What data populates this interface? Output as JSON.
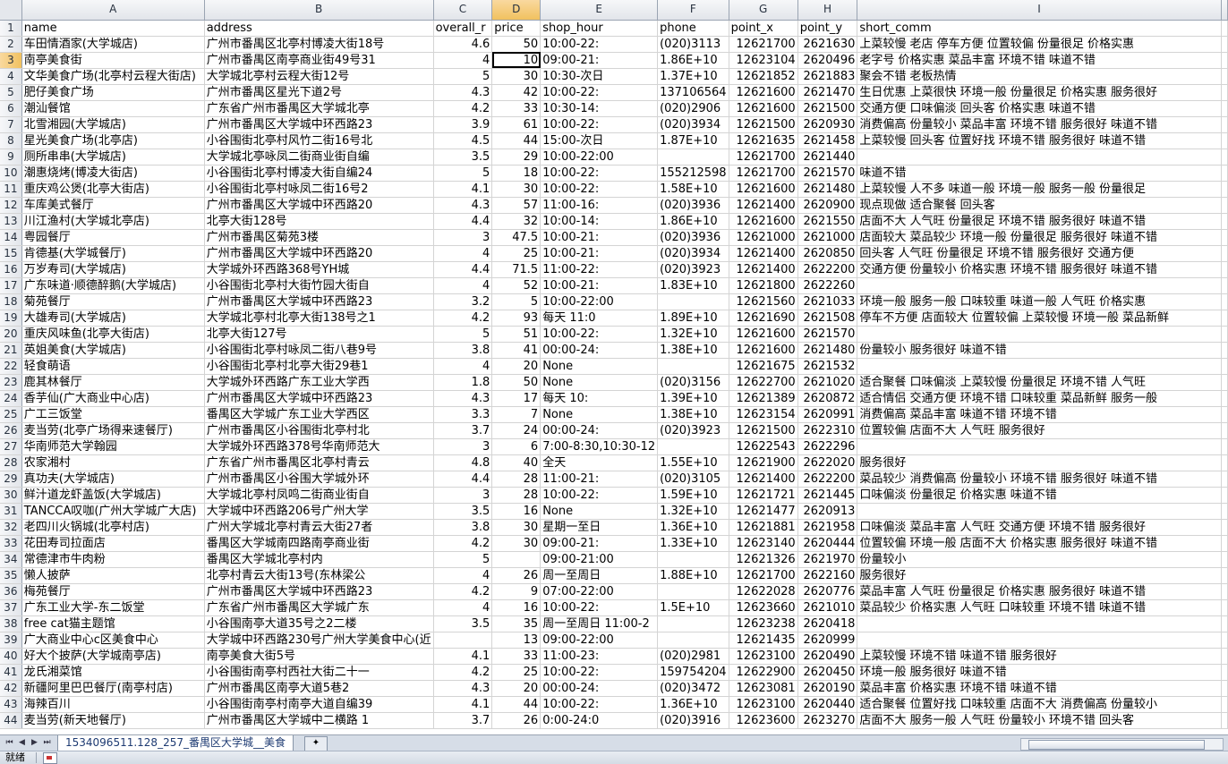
{
  "columns": [
    "A",
    "B",
    "C",
    "D",
    "E",
    "F",
    "G",
    "H",
    "I"
  ],
  "selected_column": "D",
  "selected_row": 3,
  "rows": [
    {
      "n": "1",
      "c": [
        "name",
        "address",
        "overall_r",
        "price",
        "shop_hour",
        "phone",
        "point_x",
        "point_y",
        "short_comm"
      ]
    },
    {
      "n": "2",
      "c": [
        "车田情酒家(大学城店)",
        "广州市番禺区北亭村博凌大街18号",
        "4.6",
        "50",
        "10:00-22:",
        "(020)3113",
        "12621700",
        "2621630",
        "上菜较慢 老店 停车方便 位置较偏 份量很足 价格实惠"
      ]
    },
    {
      "n": "3",
      "c": [
        "南亭美食街",
        "广州市番禺区南亭商业街49号31",
        "4",
        "10",
        "09:00-21:",
        "1.86E+10",
        "12623104",
        "2620496",
        "老字号 价格实惠 菜品丰富 环境不错 味道不错"
      ]
    },
    {
      "n": "4",
      "c": [
        "文华美食广场(北亭村云程大街店)",
        "大学城北亭村云程大街12号",
        "5",
        "30",
        "10:30-次日",
        "1.37E+10",
        "12621852",
        "2621883",
        "聚会不错 老板热情"
      ]
    },
    {
      "n": "5",
      "c": [
        "肥仔美食广场",
        "广州市番禺区星光下道2号",
        "4.3",
        "42",
        "10:00-22:",
        "137106564",
        "12621600",
        "2621470",
        "生日优惠 上菜很快 环境一般 份量很足 价格实惠 服务很好"
      ]
    },
    {
      "n": "6",
      "c": [
        "潮汕餐馆",
        "广东省广州市番禺区大学城北亭",
        "4.2",
        "33",
        "10:30-14:",
        "(020)2906",
        "12621600",
        "2621500",
        "交通方便 口味偏淡 回头客 价格实惠 味道不错"
      ]
    },
    {
      "n": "7",
      "c": [
        "北雪湘园(大学城店)",
        "广州市番禺区大学城中环西路23",
        "3.9",
        "61",
        "10:00-22:",
        "(020)3934",
        "12621500",
        "2620930",
        "消费偏高 份量较小 菜品丰富 环境不错 服务很好 味道不错"
      ]
    },
    {
      "n": "8",
      "c": [
        "星光美食广场(北亭店)",
        "小谷围街北亭村风竹二街16号北",
        "4.5",
        "44",
        "15:00-次日",
        "1.87E+10",
        "12621635",
        "2621458",
        "上菜较慢 回头客 位置好找 环境不错 服务很好 味道不错"
      ]
    },
    {
      "n": "9",
      "c": [
        "厕所串串(大学城店)",
        "大学城北亭咏凤二街商业街自编",
        "3.5",
        "29",
        "10:00-22:00",
        "",
        "12621700",
        "2621440",
        ""
      ]
    },
    {
      "n": "10",
      "c": [
        "潮惠烧烤(博凌大街店)",
        "小谷围街北亭村博凌大街自编24",
        "5",
        "18",
        "10:00-22:",
        "155212598",
        "12621700",
        "2621570",
        "味道不错"
      ]
    },
    {
      "n": "11",
      "c": [
        "重庆鸡公煲(北亭大街店)",
        "小谷围街北亭村咏凤二街16号2",
        "4.1",
        "30",
        "10:00-22:",
        "1.58E+10",
        "12621600",
        "2621480",
        "上菜较慢 人不多 味道一般 环境一般 服务一般 份量很足"
      ]
    },
    {
      "n": "12",
      "c": [
        "车库美式餐厅",
        "广州市番禺区大学城中环西路20",
        "4.3",
        "57",
        "11:00-16:",
        "(020)3936",
        "12621400",
        "2620900",
        "现点现做 适合聚餐 回头客"
      ]
    },
    {
      "n": "13",
      "c": [
        "川江渔村(大学城北亭店)",
        "北亭大街128号",
        "4.4",
        "32",
        "10:00-14:",
        "1.86E+10",
        "12621600",
        "2621550",
        "店面不大 人气旺 份量很足 环境不错 服务很好 味道不错"
      ]
    },
    {
      "n": "14",
      "c": [
        "粤园餐厅",
        "广州市番禺区菊苑3楼",
        "3",
        "47.5",
        "10:00-21:",
        "(020)3936",
        "12621000",
        "2621000",
        "店面较大 菜品较少 环境一般 份量很足 服务很好 味道不错"
      ]
    },
    {
      "n": "15",
      "c": [
        "肯德基(大学城餐厅)",
        "广州市番禺区大学城中环西路20",
        "4",
        "25",
        "10:00-21:",
        "(020)3934",
        "12621400",
        "2620850",
        "回头客 人气旺 份量很足 环境不错 服务很好 交通方便"
      ]
    },
    {
      "n": "16",
      "c": [
        "万岁寿司(大学城店)",
        "大学城外环西路368号YH城",
        "4.4",
        "71.5",
        "11:00-22:",
        "(020)3923",
        "12621400",
        "2622200",
        "交通方便 份量较小 价格实惠 环境不错 服务很好 味道不错"
      ]
    },
    {
      "n": "17",
      "c": [
        "广东味道·顺德醉鹅(大学城店)",
        "小谷围街北亭村大街竹园大街自",
        "4",
        "52",
        "10:00-21:",
        "1.83E+10",
        "12621800",
        "2622260",
        ""
      ]
    },
    {
      "n": "18",
      "c": [
        "菊苑餐厅",
        "广州市番禺区大学城中环西路23",
        "3.2",
        "5",
        "10:00-22:00",
        "",
        "12621560",
        "2621033",
        "环境一般 服务一般 口味较重 味道一般 人气旺 价格实惠"
      ]
    },
    {
      "n": "19",
      "c": [
        "大雄寿司(大学城店)",
        "大学城北亭村北亭大街138号之1",
        "4.2",
        "93",
        "每天 11:0",
        "1.89E+10",
        "12621690",
        "2621508",
        "停车不方便 店面较大 位置较偏 上菜较慢 环境一般 菜品新鲜"
      ]
    },
    {
      "n": "20",
      "c": [
        "重庆风味鱼(北亭大街店)",
        "北亭大街127号",
        "5",
        "51",
        "10:00-22:",
        "1.32E+10",
        "12621600",
        "2621570",
        ""
      ]
    },
    {
      "n": "21",
      "c": [
        "英姐美食(大学城店)",
        "小谷围街北亭村咏凤二街八巷9号",
        "3.8",
        "41",
        "00:00-24:",
        "1.38E+10",
        "12621600",
        "2621480",
        "份量较小 服务很好 味道不错"
      ]
    },
    {
      "n": "22",
      "c": [
        "轻食萌语",
        "小谷围街北亭村北亭大街29巷1",
        "4",
        "20",
        "None",
        "",
        "12621675",
        "2621532",
        ""
      ]
    },
    {
      "n": "23",
      "c": [
        "鹿其林餐厅",
        "大学城外环西路广东工业大学西",
        "1.8",
        "50",
        "None",
        "(020)3156",
        "12622700",
        "2621020",
        "适合聚餐 口味偏淡 上菜较慢 份量很足 环境不错 人气旺"
      ]
    },
    {
      "n": "24",
      "c": [
        "香芋仙(广大商业中心店)",
        "广州市番禺区大学城中环西路23",
        "4.3",
        "17",
        "每天 10:",
        "1.39E+10",
        "12621389",
        "2620872",
        "适合情侣 交通方便 环境不错 口味较重 菜品新鲜 服务一般"
      ]
    },
    {
      "n": "25",
      "c": [
        "广工三饭堂",
        "番禺区大学城广东工业大学西区",
        "3.3",
        "7",
        "None",
        "1.38E+10",
        "12623154",
        "2620991",
        "消费偏高 菜品丰富 味道不错 环境不错"
      ]
    },
    {
      "n": "26",
      "c": [
        "麦当劳(北亭广场得来速餐厅)",
        "广州市番禺区小谷围街北亭村北",
        "3.7",
        "24",
        "00:00-24:",
        "(020)3923",
        "12621500",
        "2622310",
        "位置较偏 店面不大 人气旺 服务很好"
      ]
    },
    {
      "n": "27",
      "c": [
        "华南师范大学翰园",
        "大学城外环西路378号华南师范大",
        "3",
        "6",
        "7:00-8:30,10:30-12",
        "",
        "12622543",
        "2622296",
        ""
      ]
    },
    {
      "n": "28",
      "c": [
        "农家湘村",
        "广东省广州市番禺区北亭村青云",
        "4.8",
        "40",
        "全天",
        "1.55E+10",
        "12621900",
        "2622020",
        "服务很好"
      ]
    },
    {
      "n": "29",
      "c": [
        "真功夫(大学城店)",
        "广州市番禺区小谷围大学城外环",
        "4.4",
        "28",
        "11:00-21:",
        "(020)3105",
        "12621400",
        "2622200",
        "菜品较少 消费偏高 份量较小 环境不错 服务很好 味道不错"
      ]
    },
    {
      "n": "30",
      "c": [
        "鲜汁道龙虾盖饭(大学城店)",
        "大学城北亭村凤鸣二街商业街自",
        "3",
        "28",
        "10:00-22:",
        "1.59E+10",
        "12621721",
        "2621445",
        "口味偏淡 份量很足 价格实惠 味道不错"
      ]
    },
    {
      "n": "31",
      "c": [
        "TANCCA叹咖(广州大学城广大店)",
        "大学城中环西路206号广州大学",
        "3.5",
        "16",
        "None",
        "1.32E+10",
        "12621477",
        "2620913",
        ""
      ]
    },
    {
      "n": "32",
      "c": [
        "老四川火锅城(北亭村店)",
        "广州大学城北亭村青云大街27者",
        "3.8",
        "30",
        "星期一至日",
        "1.36E+10",
        "12621881",
        "2621958",
        "口味偏淡 菜品丰富 人气旺 交通方便 环境不错 服务很好"
      ]
    },
    {
      "n": "33",
      "c": [
        "花田寿司拉面店",
        "番禺区大学城南四路南亭商业街",
        "4.2",
        "30",
        "09:00-21:",
        "1.33E+10",
        "12623140",
        "2620444",
        "位置较偏 环境一般 店面不大 价格实惠 服务很好 味道不错"
      ]
    },
    {
      "n": "34",
      "c": [
        "常德津市牛肉粉",
        "番禺区大学城北亭村内",
        "5",
        "",
        "09:00-21:00",
        "",
        "12621326",
        "2621970",
        "份量较小"
      ]
    },
    {
      "n": "35",
      "c": [
        "懒人披萨",
        "北亭村青云大街13号(东林梁公",
        "4",
        "26",
        "周一至周日",
        "1.88E+10",
        "12621700",
        "2622160",
        "服务很好"
      ]
    },
    {
      "n": "36",
      "c": [
        "梅苑餐厅",
        "广州市番禺区大学城中环西路23",
        "4.2",
        "9",
        "07:00-22:00",
        "",
        "12622028",
        "2620776",
        "菜品丰富 人气旺 份量很足 价格实惠 服务很好 味道不错"
      ]
    },
    {
      "n": "37",
      "c": [
        "广东工业大学-东二饭堂",
        "广东省广州市番禺区大学城广东",
        "4",
        "16",
        "10:00-22:",
        "1.5E+10",
        "12623660",
        "2621010",
        "菜品较少 价格实惠 人气旺 口味较重 环境不错 味道不错"
      ]
    },
    {
      "n": "38",
      "c": [
        "free cat猫主题馆",
        "小谷围南亭大道35号之2二楼",
        "3.5",
        "35",
        "周一至周日 11:00-2",
        "",
        "12623238",
        "2620418",
        ""
      ]
    },
    {
      "n": "39",
      "c": [
        "广大商业中心c区美食中心",
        "大学城中环西路230号广州大学美食中心(近",
        "",
        "13",
        "09:00-22:00",
        "",
        "12621435",
        "2620999",
        ""
      ]
    },
    {
      "n": "40",
      "c": [
        "好大个披萨(大学城南亭店)",
        "南亭美食大街5号",
        "4.1",
        "33",
        "11:00-23:",
        "(020)2981",
        "12623100",
        "2620490",
        "上菜较慢 环境不错 味道不错 服务很好"
      ]
    },
    {
      "n": "41",
      "c": [
        "龙氏湘菜馆",
        "小谷围街南亭村西社大街二十一",
        "4.2",
        "25",
        "10:00-22:",
        "159754204",
        "12622900",
        "2620450",
        "环境一般 服务很好 味道不错"
      ]
    },
    {
      "n": "42",
      "c": [
        "新疆阿里巴巴餐厅(南亭村店)",
        "广州市番禺区南亭大道5巷2",
        "4.3",
        "20",
        "00:00-24:",
        "(020)3472",
        "12623081",
        "2620190",
        "菜品丰富 价格实惠 环境不错 味道不错"
      ]
    },
    {
      "n": "43",
      "c": [
        "海辣百川",
        "小谷围街南亭村南亭大道自编39",
        "4.1",
        "44",
        "10:00-22:",
        "1.36E+10",
        "12623100",
        "2620440",
        "适合聚餐 位置好找 口味较重 店面不大 消费偏高 份量较小"
      ]
    },
    {
      "n": "44",
      "c": [
        "麦当劳(新天地餐厅)",
        "广州市番禺区大学城中二横路 1",
        "3.7",
        "26",
        "0:00-24:0",
        "(020)3916",
        "12623600",
        "2623270",
        "店面不大 服务一般 人气旺 份量较小 环境不错 回头客"
      ]
    }
  ],
  "sheet_tab": "1534096511.128_257_番禺区大学城__美食",
  "status": "就绪"
}
